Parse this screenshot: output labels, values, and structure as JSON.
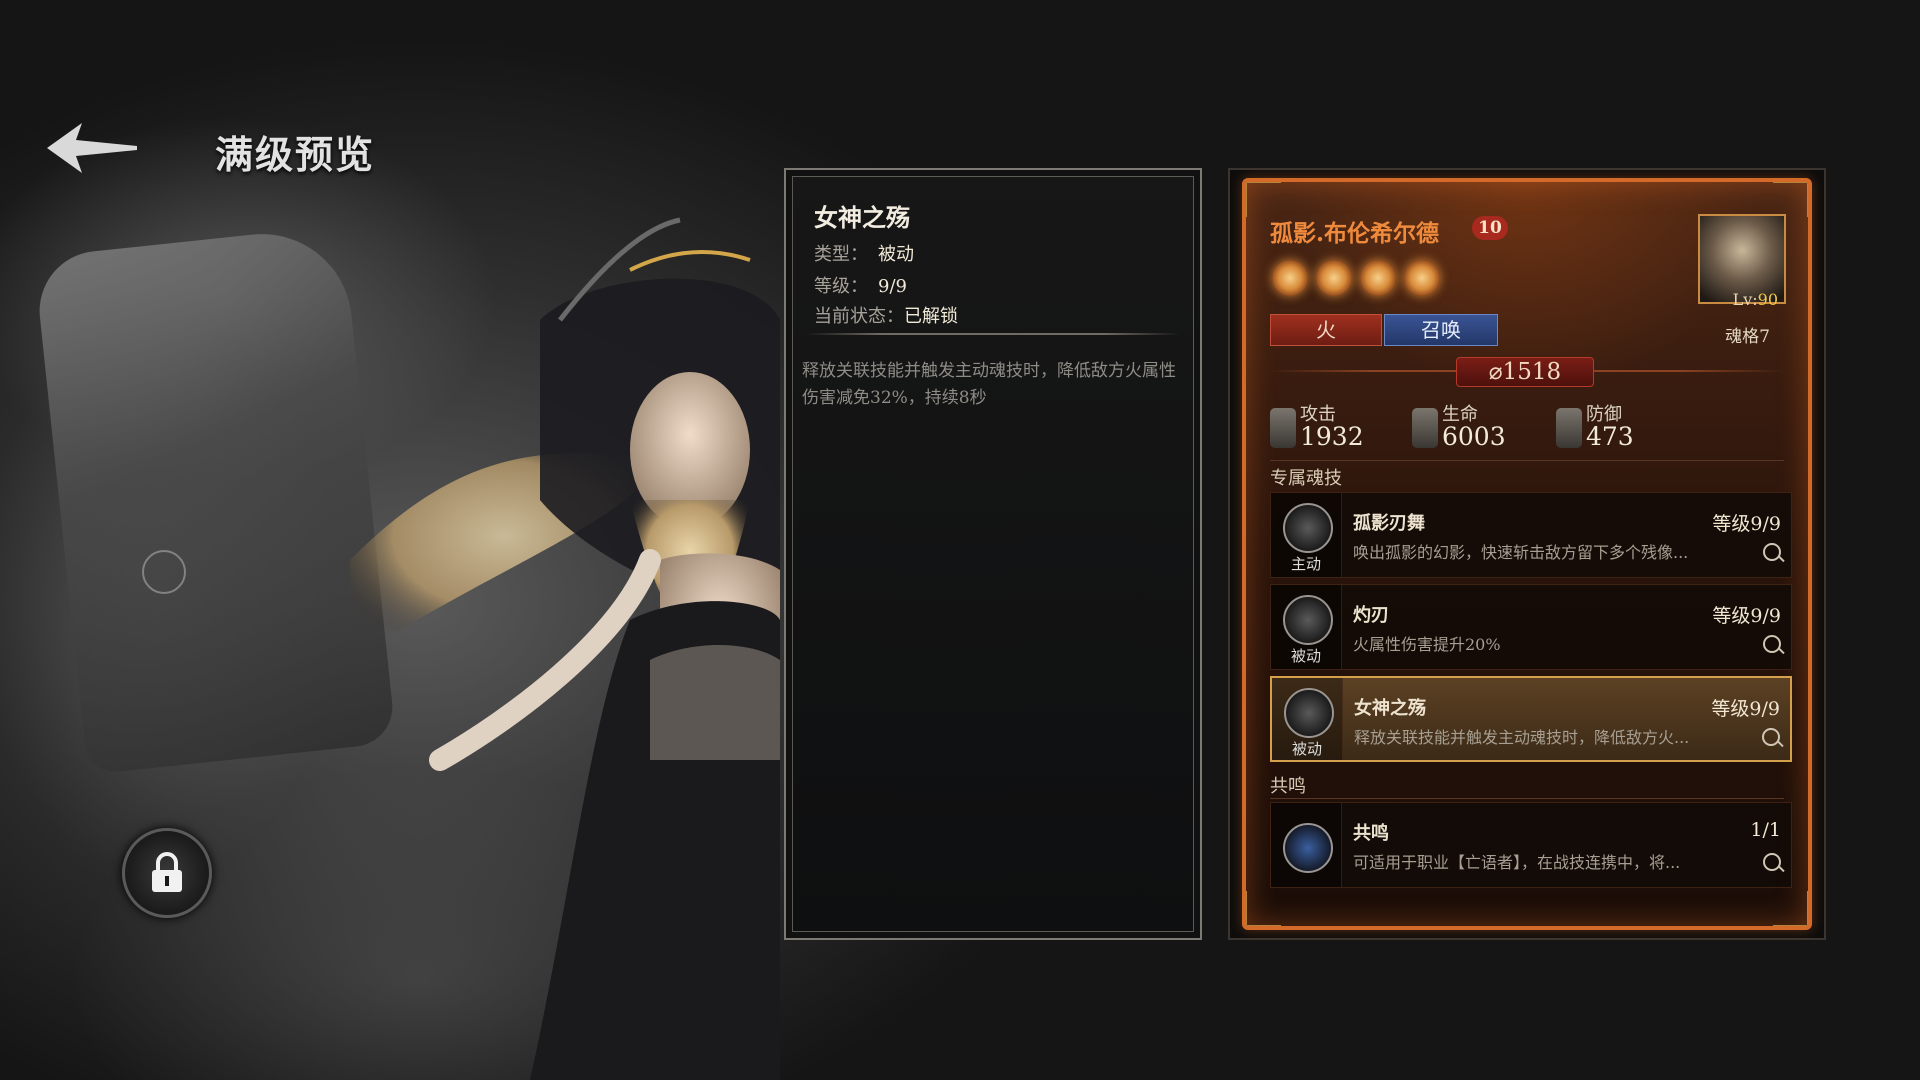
{
  "header": {
    "title": "满级预览"
  },
  "detail": {
    "name": "女神之殇",
    "type_label": "类型：",
    "type_value": "被动",
    "level_label": "等级：",
    "level_value": "9/9",
    "status_label": "当前状态：",
    "status_value": "已解锁",
    "description": "释放关联技能并触发主动魂技时，降低敌方火属性伤害减免32%，持续8秒"
  },
  "hero": {
    "name": "孤影.布伦希尔德",
    "rank": "10",
    "stars": 4,
    "tags": {
      "element": "火",
      "class": "召唤"
    },
    "portrait": {
      "level_label": "Lv:",
      "level_value": "90"
    },
    "soul_grade": "魂格7",
    "power": "1518",
    "stats": [
      {
        "label": "攻击",
        "value": "1932"
      },
      {
        "label": "生命",
        "value": "6003"
      },
      {
        "label": "防御",
        "value": "473"
      }
    ],
    "sections": {
      "exclusive": "专属魂技",
      "resonance": "共鸣"
    },
    "skills": [
      {
        "name": "孤影刃舞",
        "type": "主动",
        "level": "等级9/9",
        "desc": "唤出孤影的幻影，快速斩击敌方留下多个残像..."
      },
      {
        "name": "灼刃",
        "type": "被动",
        "level": "等级9/9",
        "desc": "火属性伤害提升20%"
      },
      {
        "name": "女神之殇",
        "type": "被动",
        "level": "等级9/9",
        "desc": "释放关联技能并触发主动魂技时，降低敌方火..."
      }
    ],
    "resonance": {
      "name": "共鸣",
      "level": "1/1",
      "desc": "可适用于职业【亡语者】，在战技连携中，将..."
    }
  },
  "colors": {
    "accent": "#d46a2a",
    "fire": "#a0301f",
    "summon": "#3a5595",
    "highlight": "#d4a04c"
  }
}
